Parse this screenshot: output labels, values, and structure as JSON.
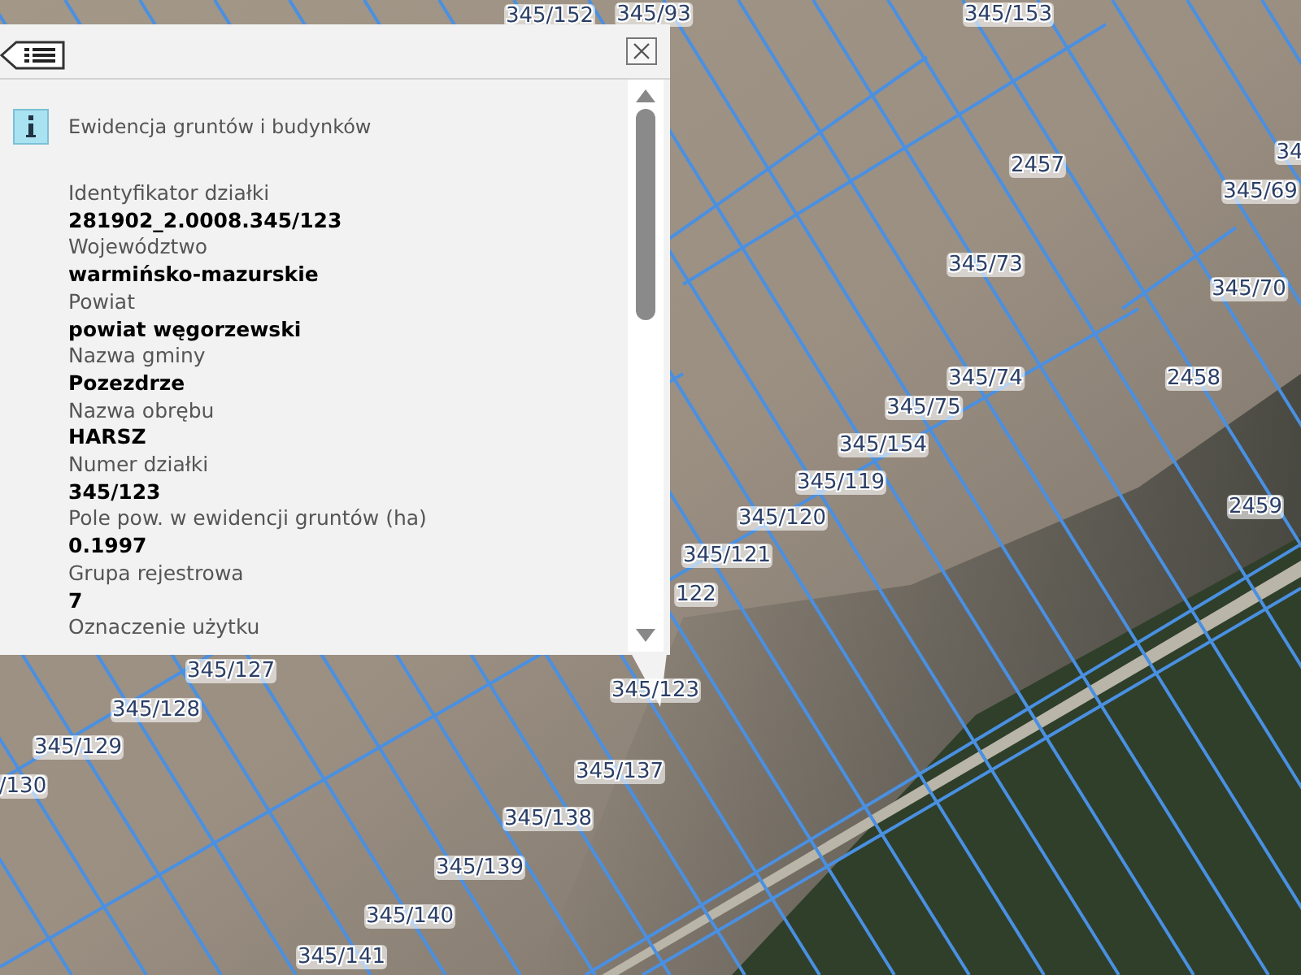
{
  "map": {
    "parcel_labels": [
      "345/152",
      "345/93",
      "345/153",
      "2457",
      "34",
      "345/69",
      "345/73",
      "345/70",
      "345/74",
      "2458",
      "345/75",
      "345/154",
      "345/119",
      "345/120",
      "2459",
      "345/121",
      "122",
      "345/127",
      "345/128",
      "345/123",
      "345/129",
      "/130",
      "345/137",
      "345/138",
      "345/139",
      "345/140",
      "345/141"
    ]
  },
  "popup": {
    "title": "Ewidencja gruntów i budynków",
    "fields": [
      {
        "label": "Identyfikator działki",
        "value": "281902_2.0008.345/123"
      },
      {
        "label": "Województwo",
        "value": "warmińsko-mazurskie"
      },
      {
        "label": "Powiat",
        "value": "powiat węgorzewski"
      },
      {
        "label": "Nazwa gminy",
        "value": "Pozezdrze"
      },
      {
        "label": "Nazwa obrębu",
        "value": "HARSZ"
      },
      {
        "label": "Numer działki",
        "value": "345/123"
      },
      {
        "label": "Pole pow. w ewidencji gruntów (ha)",
        "value": "0.1997"
      },
      {
        "label": "Grupa rejestrowa",
        "value": "7"
      },
      {
        "label": "Oznaczenie użytku"
      }
    ]
  }
}
